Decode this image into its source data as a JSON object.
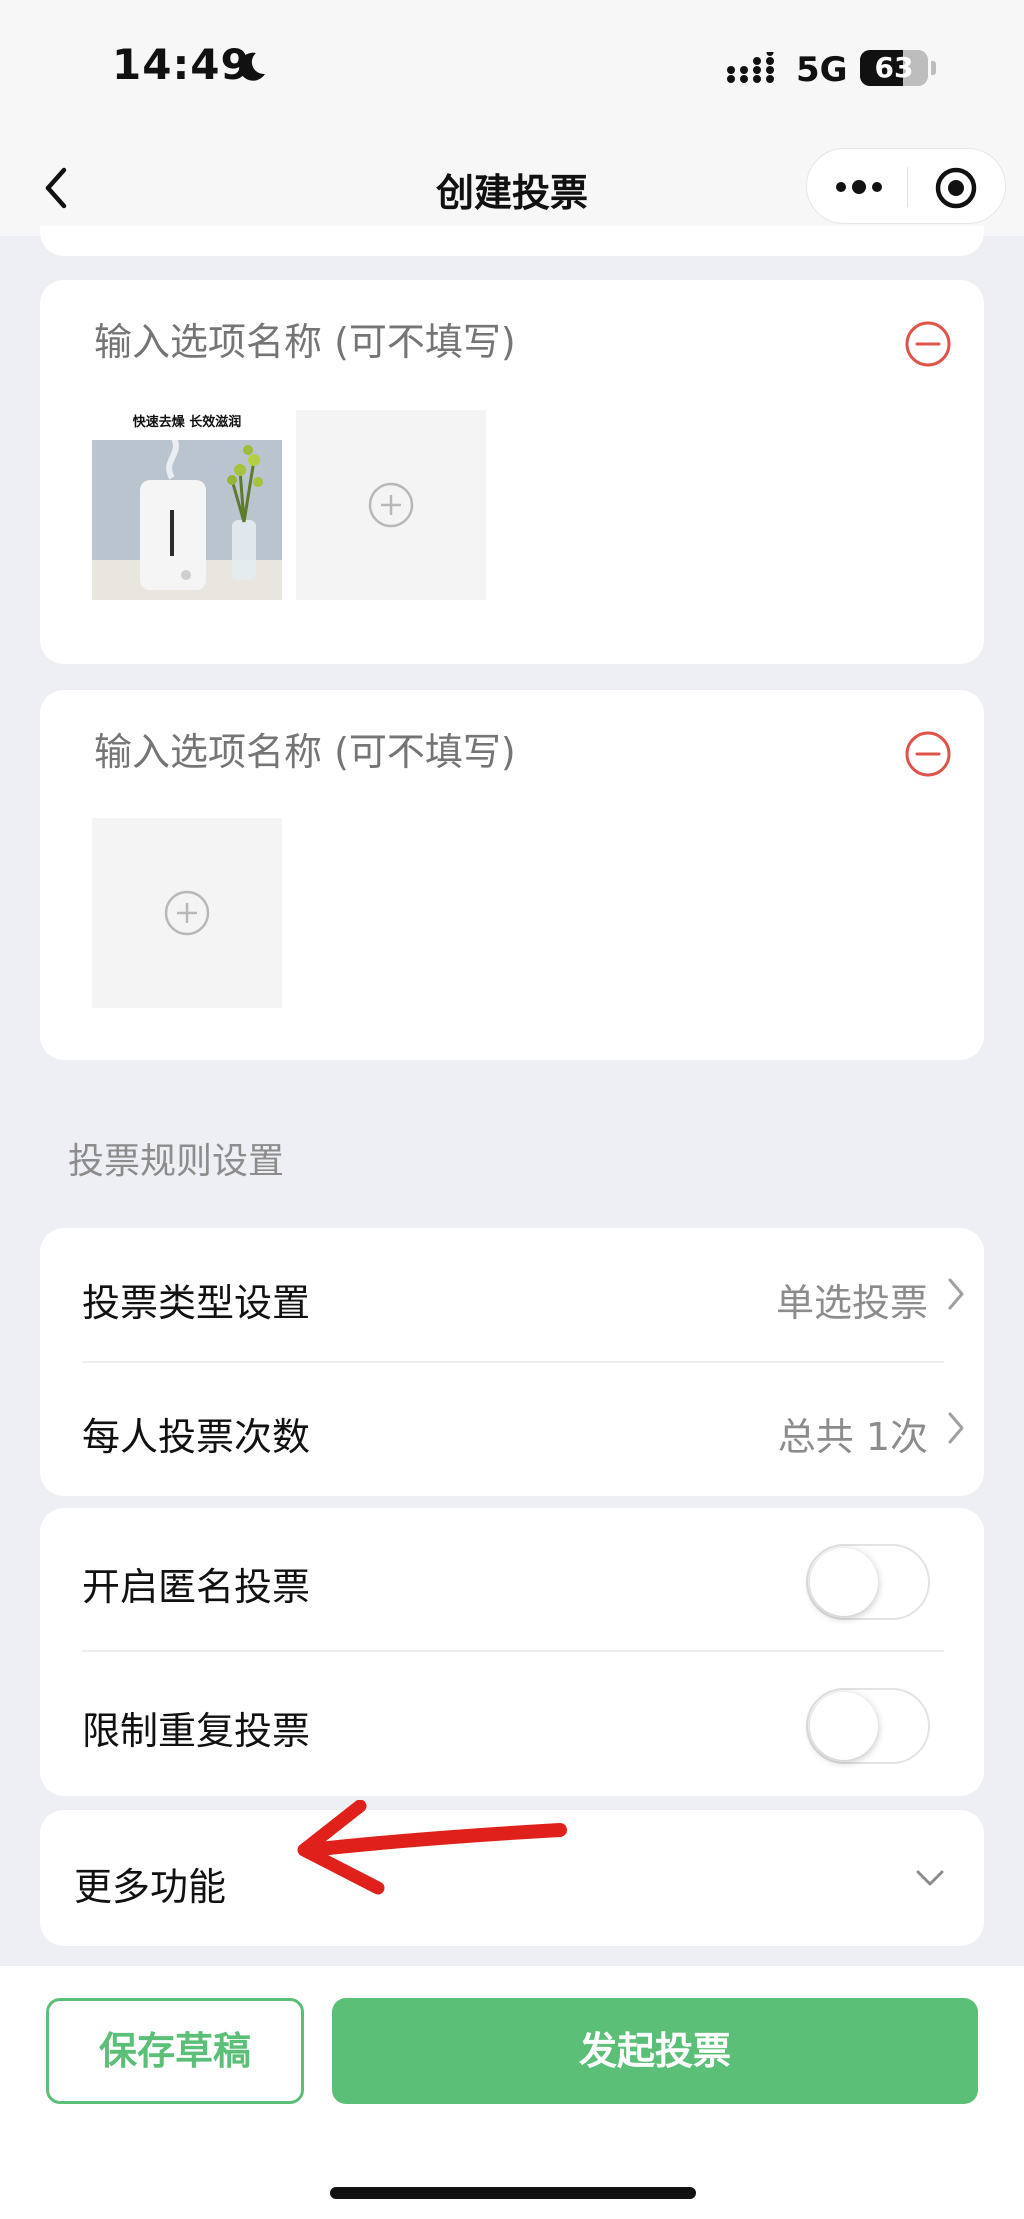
{
  "status_bar": {
    "time": "14:49",
    "network": "5G",
    "battery": "63",
    "battery_level": 0.63
  },
  "nav": {
    "title": "创建投票"
  },
  "options": [
    {
      "placeholder": "输入选项名称 (可不填写)",
      "image_caption": "快速去燥 长效滋润"
    },
    {
      "placeholder": "输入选项名称 (可不填写)"
    }
  ],
  "rules": {
    "section_title": "投票规则设置",
    "vote_type": {
      "label": "投票类型设置",
      "value": "单选投票"
    },
    "vote_count": {
      "label": "每人投票次数",
      "value": "总共 1次"
    },
    "anonymous": {
      "label": "开启匿名投票",
      "enabled": false
    },
    "limit_repeat": {
      "label": "限制重复投票",
      "enabled": false
    },
    "more": {
      "label": "更多功能"
    }
  },
  "footer": {
    "save_label": "保存草稿",
    "submit_label": "发起投票"
  },
  "colors": {
    "accent": "#5bbf78",
    "danger": "#e0534a",
    "annotation_arrow": "#e0201b"
  }
}
